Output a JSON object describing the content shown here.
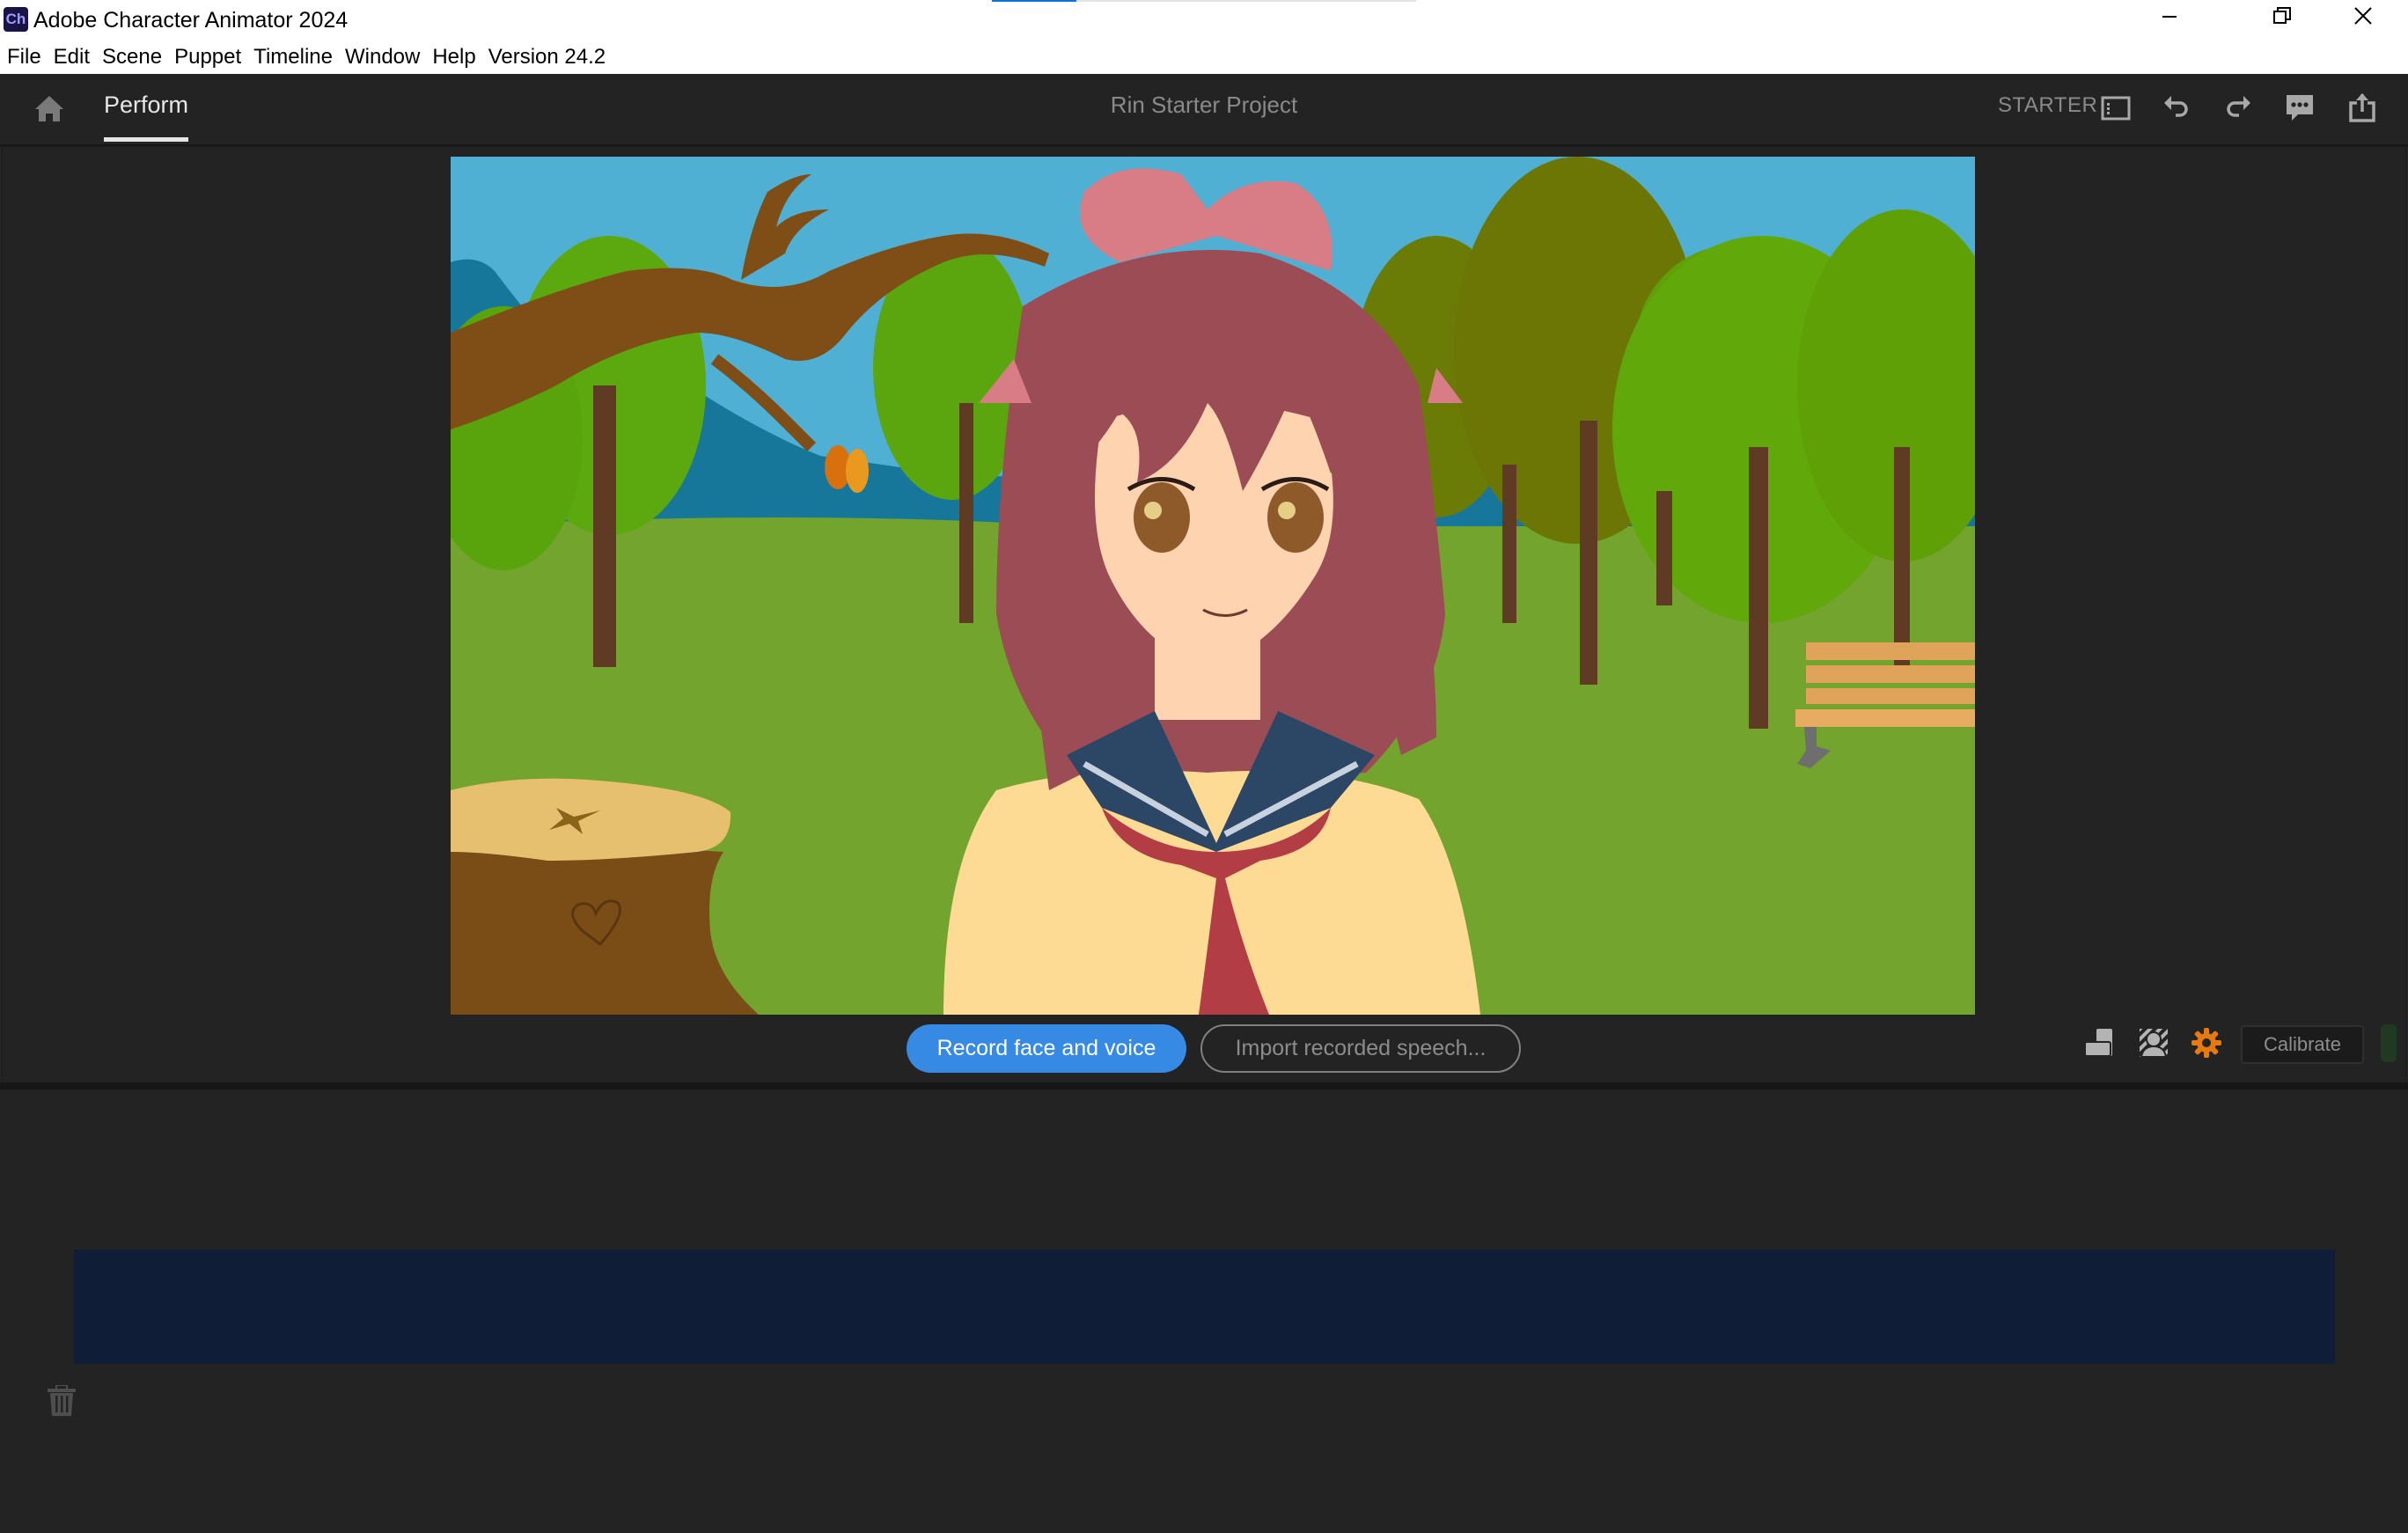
{
  "window": {
    "app_icon_label": "Ch",
    "title": "Adobe Character Animator 2024",
    "loading_progress_percent": 20,
    "controls": {
      "minimize": "–",
      "restore": "❐",
      "close": "✕"
    }
  },
  "menu": {
    "items": [
      {
        "label": "File"
      },
      {
        "label": "Edit"
      },
      {
        "label": "Scene"
      },
      {
        "label": "Puppet"
      },
      {
        "label": "Timeline"
      },
      {
        "label": "Window"
      },
      {
        "label": "Help"
      },
      {
        "label": "Version 24.2"
      }
    ]
  },
  "header": {
    "home_icon": "home-icon",
    "tab_label": "Perform",
    "project_title": "Rin Starter Project",
    "plan_label": "STARTER",
    "icons": [
      "panel-layout-icon",
      "undo-icon",
      "redo-icon",
      "feedback-icon",
      "share-icon"
    ]
  },
  "stage": {
    "scene_description": "Anime girl puppet (Rin) with pink bow and sailor uniform in an autumn park",
    "colors": {
      "sky": "#4fb0d3",
      "mountain": "#17779a",
      "grass": "#73a42e",
      "hair": "#9c4c55",
      "bow": "#d87c86",
      "skin": "#fdd3b0",
      "shirt": "#fedb94",
      "collar": "#2c4766",
      "scarf": "#b33d45"
    }
  },
  "controls": {
    "record_label": "Record face and voice",
    "import_label": "Import recorded speech...",
    "calibrate_label": "Calibrate",
    "icons": [
      "layers-icon",
      "background-removal-icon",
      "settings-gear-icon"
    ],
    "accent_gear_color": "#e6790f",
    "record_color": "#378ae3"
  },
  "timeline": {
    "take_bar_color": "#0f1e36",
    "trash_icon": "trash-icon"
  }
}
